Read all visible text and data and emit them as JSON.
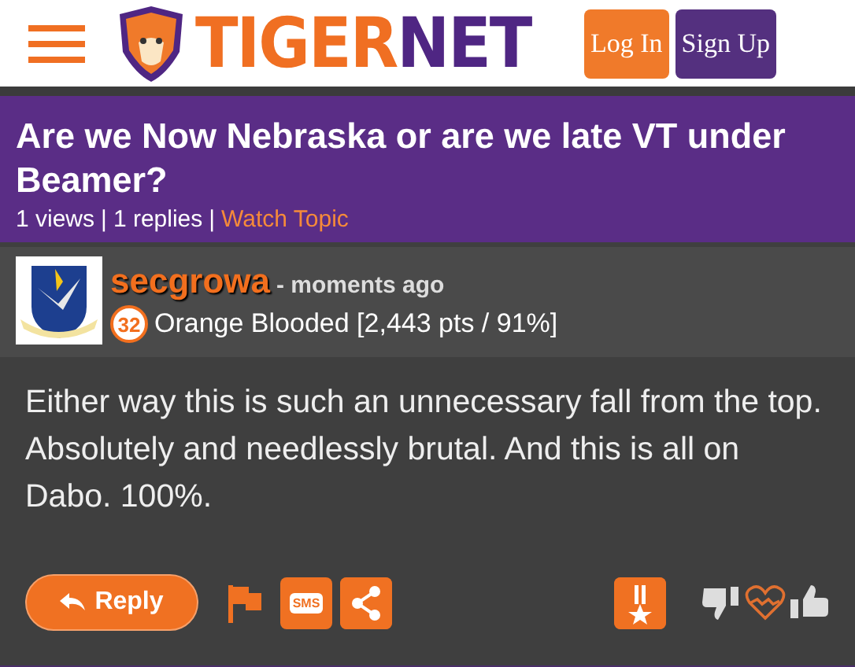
{
  "header": {
    "logo": {
      "first": "TIGER",
      "second": "NET"
    },
    "buttons": [
      {
        "label": "Log In",
        "kind": "login"
      },
      {
        "label": "Sign Up",
        "kind": "signup"
      }
    ]
  },
  "topic": {
    "title": "Are we Now Nebraska or are we late VT under Beamer?",
    "views": "1 views",
    "separator_1": "|",
    "replies": "1 replies",
    "separator_2": "|",
    "watch": "Watch Topic"
  },
  "post": {
    "author": "secgrowa",
    "time": "- moments ago",
    "rank_number": "32",
    "rank": "Orange Blooded [2,443 pts / 91%]",
    "body": "Either way this is such an unnecessary fall from the top. Absolutely and needlessly brutal. And this is all on Dabo. 100%.",
    "reply": "Reply",
    "sms": "SMS"
  }
}
